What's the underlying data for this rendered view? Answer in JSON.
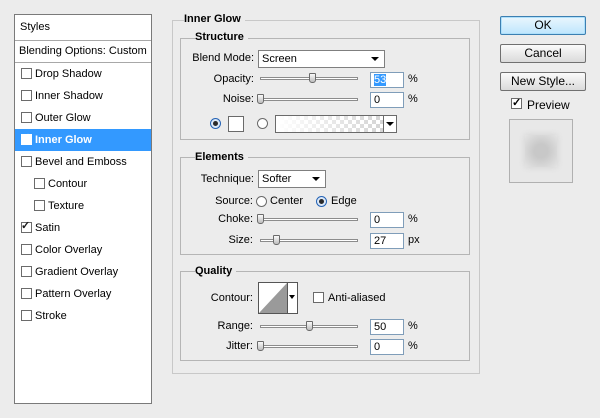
{
  "styles_panel": {
    "header": "Styles",
    "blending_options": "Blending Options: Custom",
    "items": [
      {
        "label": "Drop Shadow",
        "checked": false,
        "selected": false,
        "sub": false
      },
      {
        "label": "Inner Shadow",
        "checked": false,
        "selected": false,
        "sub": false
      },
      {
        "label": "Outer Glow",
        "checked": false,
        "selected": false,
        "sub": false
      },
      {
        "label": "Inner Glow",
        "checked": true,
        "selected": true,
        "sub": false
      },
      {
        "label": "Bevel and Emboss",
        "checked": false,
        "selected": false,
        "sub": false
      },
      {
        "label": "Contour",
        "checked": false,
        "selected": false,
        "sub": true
      },
      {
        "label": "Texture",
        "checked": false,
        "selected": false,
        "sub": true
      },
      {
        "label": "Satin",
        "checked": true,
        "selected": false,
        "sub": false
      },
      {
        "label": "Color Overlay",
        "checked": false,
        "selected": false,
        "sub": false
      },
      {
        "label": "Gradient Overlay",
        "checked": false,
        "selected": false,
        "sub": false
      },
      {
        "label": "Pattern Overlay",
        "checked": false,
        "selected": false,
        "sub": false
      },
      {
        "label": "Stroke",
        "checked": false,
        "selected": false,
        "sub": false
      }
    ]
  },
  "inner_glow": {
    "title": "Inner Glow",
    "structure": {
      "title": "Structure",
      "blend_mode_label": "Blend Mode:",
      "blend_mode_value": "Screen",
      "opacity_label": "Opacity:",
      "opacity_value": "53",
      "opacity_unit": "%",
      "noise_label": "Noise:",
      "noise_value": "0",
      "noise_unit": "%",
      "color_mode": "solid",
      "glow_color": "#ffffff"
    },
    "elements": {
      "title": "Elements",
      "technique_label": "Technique:",
      "technique_value": "Softer",
      "source_label": "Source:",
      "source_center": "Center",
      "source_edge": "Edge",
      "source_selected": "Edge",
      "choke_label": "Choke:",
      "choke_value": "0",
      "choke_unit": "%",
      "size_label": "Size:",
      "size_value": "27",
      "size_unit": "px"
    },
    "quality": {
      "title": "Quality",
      "contour_label": "Contour:",
      "anti_aliased_label": "Anti-aliased",
      "anti_aliased_checked": false,
      "range_label": "Range:",
      "range_value": "50",
      "range_unit": "%",
      "jitter_label": "Jitter:",
      "jitter_value": "0",
      "jitter_unit": "%"
    }
  },
  "buttons": {
    "ok": "OK",
    "cancel": "Cancel",
    "new_style": "New Style...",
    "preview_label": "Preview",
    "preview_checked": true
  },
  "colors": {
    "selection": "#3399ff",
    "dialog_bg": "#ececec"
  }
}
